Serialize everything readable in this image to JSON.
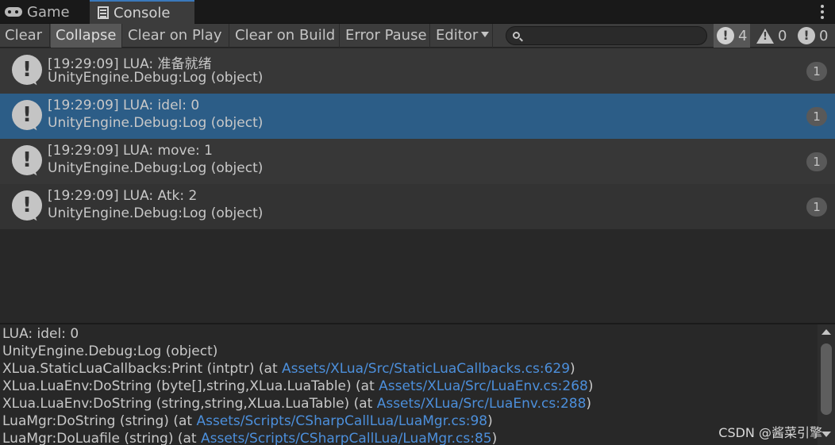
{
  "tabs": [
    {
      "label": "Game",
      "icon": "gamepad-icon"
    },
    {
      "label": "Console",
      "icon": "console-icon",
      "active": true
    }
  ],
  "toolbar": {
    "clear": "Clear",
    "collapse": "Collapse",
    "clear_on_play": "Clear on Play",
    "clear_on_build": "Clear on Build",
    "error_pause": "Error Pause",
    "editor": "Editor",
    "search_placeholder": "",
    "log_count": "4",
    "warning_count": "0",
    "error_count": "0"
  },
  "logs": [
    {
      "line1": "[19:29:09] LUA: 准备就绪",
      "line2": "UnityEngine.Debug:Log (object)",
      "count": "1"
    },
    {
      "line1": "[19:29:09] LUA: idel: 0",
      "line2": "UnityEngine.Debug:Log (object)",
      "count": "1",
      "selected": true
    },
    {
      "line1": "[19:29:09] LUA: move: 1",
      "line2": "UnityEngine.Debug:Log (object)",
      "count": "1"
    },
    {
      "line1": "[19:29:09] LUA: Atk: 2",
      "line2": "UnityEngine.Debug:Log (object)",
      "count": "1"
    }
  ],
  "detail": {
    "l1": "LUA: idel: 0",
    "l2": "UnityEngine.Debug:Log (object)",
    "l3_text": "XLua.StaticLuaCallbacks:Print (intptr) (at ",
    "l3_link": "Assets/XLua/Src/StaticLuaCallbacks.cs:629",
    "l4_text": "XLua.LuaEnv:DoString (byte[],string,XLua.LuaTable) (at ",
    "l4_link": "Assets/XLua/Src/LuaEnv.cs:268",
    "l5_text": "XLua.LuaEnv:DoString (string,string,XLua.LuaTable) (at ",
    "l5_link": "Assets/XLua/Src/LuaEnv.cs:288",
    "l6_text": "LuaMgr:DoString (string) (at ",
    "l6_link": "Assets/Scripts/CSharpCallLua/LuaMgr.cs:98",
    "l7_text": "LuaMgr:DoLuafile (string) (at ",
    "l7_link": "Assets/Scripts/CSharpCallLua/LuaMgr.cs:85",
    "close_paren": ")"
  },
  "watermark": "CSDN @酱菜引擎"
}
